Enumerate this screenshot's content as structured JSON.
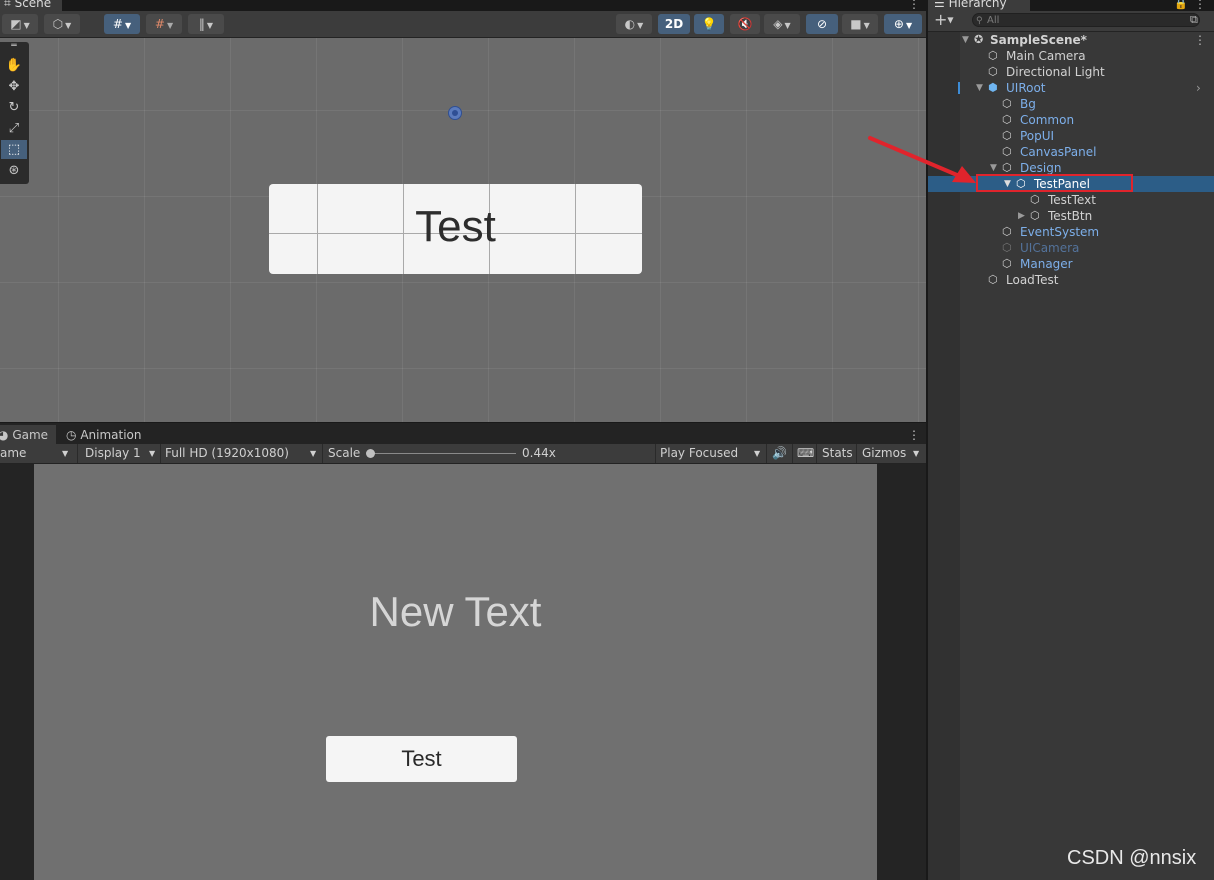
{
  "scene": {
    "tab_label": "Scene",
    "toolbar": {
      "mode_2d": "2D"
    },
    "panel_text": "Test"
  },
  "game": {
    "tabs": [
      {
        "label": "Game"
      },
      {
        "label": "Animation"
      }
    ],
    "toolbar": {
      "view_mode": "ame",
      "display": "Display 1",
      "resolution": "Full HD (1920x1080)",
      "scale_label": "Scale",
      "scale_value": "0.44x",
      "scale_fraction": 0.02,
      "play_mode": "Play Focused",
      "stats": "Stats",
      "gizmos": "Gizmos"
    },
    "canvas": {
      "text": "New Text",
      "button_label": "Test"
    }
  },
  "hierarchy": {
    "tab_label": "Hierarchy",
    "search_placeholder": "All",
    "scene_name": "SampleScene*",
    "items": [
      {
        "label": "Main Camera"
      },
      {
        "label": "Directional Light"
      },
      {
        "label": "UIRoot"
      },
      {
        "label": "Bg"
      },
      {
        "label": "Common"
      },
      {
        "label": "PopUI"
      },
      {
        "label": "CanvasPanel"
      },
      {
        "label": "Design"
      },
      {
        "label": "TestPanel"
      },
      {
        "label": "TestText"
      },
      {
        "label": "TestBtn"
      },
      {
        "label": "EventSystem"
      },
      {
        "label": "UICamera"
      },
      {
        "label": "Manager"
      },
      {
        "label": "LoadTest"
      }
    ]
  },
  "colors": {
    "selection": "#2c5d87",
    "annotation": "#e0242c",
    "prefab_text": "#7dafea"
  },
  "watermark": "CSDN @nnsix"
}
